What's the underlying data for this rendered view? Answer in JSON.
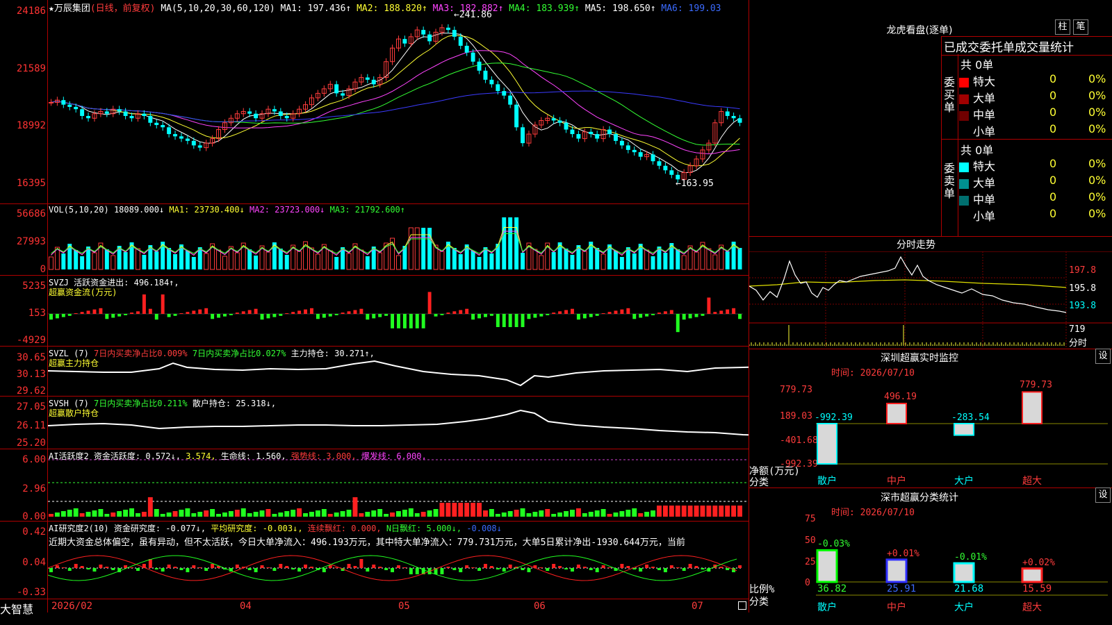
{
  "stock": {
    "name": "★万辰集团",
    "mode": "(日线，前复权)"
  },
  "ma_header": {
    "label": "MA(5,10,20,30,60,120)",
    "ma1": "MA1: 197.436↑",
    "ma2": "MA2: 188.820↑",
    "ma3": "MA3: 182.882↑",
    "ma4": "MA4: 183.939↑",
    "ma5": "MA5: 198.650↑",
    "ma6": "MA6: 199.03"
  },
  "price_axis": [
    "24186",
    "21589",
    "18992",
    "16395"
  ],
  "price_notes": {
    "high": "241.86",
    "low": "163.95"
  },
  "vol_header": {
    "label": "VOL(5,10,20)",
    "v": "18089.000↓",
    "ma1": "MA1: 23730.400↓",
    "ma2": "MA2: 23723.000↓",
    "ma3": "MA3: 21792.600↑"
  },
  "vol_axis": [
    "56686",
    "27993",
    "0"
  ],
  "svzj": {
    "label": "SVZJ",
    "name": "活跃资金进出:",
    "value": "496.184↑,",
    "sub": "超赢资金流(万元)"
  },
  "svzj_axis": [
    "5235",
    "153",
    "-4929"
  ],
  "svzl": {
    "label": "SVZL (7)",
    "t1": "7日内买卖净占比0.009%",
    "t2": "7日内买卖净占比0.027%",
    "t3": "主力持仓: 30.271↑,",
    "sub": "超赢主力持仓"
  },
  "svzl_axis": [
    "30.65",
    "30.13",
    "29.62"
  ],
  "svsh": {
    "label": "SVSH (7)",
    "t1": "7日内买卖净占比0.211%",
    "t2": "散户持仓: 25.318↓,",
    "sub": "超赢散户持仓"
  },
  "svsh_axis": [
    "27.05",
    "26.11",
    "25.20"
  ],
  "ai1": {
    "label": "AI活跃度2",
    "t1": "资金活跃度: 0.572↓,",
    "t2": "3.574,",
    "t3": "生命线: 1.560,",
    "t4": "强势线: 3.000,",
    "t5": "爆发线: 6.000,"
  },
  "ai1_axis": [
    "6.00",
    "2.96",
    "0.00"
  ],
  "ai2": {
    "label": "AI研究度2(10)",
    "t1": "资金研究度: -0.077↓,",
    "t2": "平均研究度: -0.003↓,",
    "t3": "连续飘红: 0.000,",
    "t4": "N日飘红: 5.000↓,",
    "t5": "-0.008↓",
    "comment": "近期大资金总体偏空，虽有异动，但不太活跃，今日大单净流入：496.193万元，其中特大单净流入：779.731万元，大单5日累计净出-1930.644万元，当前"
  },
  "ai2_axis": [
    "0.42",
    "0.04",
    "-0.33"
  ],
  "date_axis": [
    "2026/02",
    "04",
    "05",
    "06",
    "07"
  ],
  "brand": "大智慧",
  "right": {
    "lhb_title": "龙虎看盘(逐单)",
    "btn_zhu": "柱",
    "btn_bi": "笔",
    "stat_title": "已成交委托单成交量统计",
    "buy_side": "委买单",
    "sell_side": "委卖单",
    "buy_total": "共 0单",
    "sell_total": "共 0单",
    "buy_rows": [
      {
        "name": "特大",
        "val": "0",
        "pct": "0%",
        "color": "#ff0000"
      },
      {
        "name": "大单",
        "val": "0",
        "pct": "0%",
        "color": "#a00000"
      },
      {
        "name": "中单",
        "val": "0",
        "pct": "0%",
        "color": "#700000"
      },
      {
        "name": "小单",
        "val": "0",
        "pct": "0%",
        "color": ""
      }
    ],
    "sell_rows": [
      {
        "name": "特大",
        "val": "0",
        "pct": "0%",
        "color": "#00ffff"
      },
      {
        "name": "大单",
        "val": "0",
        "pct": "0%",
        "color": "#009090"
      },
      {
        "name": "中单",
        "val": "0",
        "pct": "0%",
        "color": "#006f6f"
      },
      {
        "name": "小单",
        "val": "0",
        "pct": "0%",
        "color": ""
      }
    ],
    "fs_title": "分时走势",
    "fs_axis": [
      "197.8",
      "195.8",
      "193.8"
    ],
    "fs_vol": "719",
    "fs_unit": "分时",
    "sz_title": "深圳超赢实时监控",
    "sz_btn": "设",
    "sz_time": "时间: 2026/07/10",
    "sz_axis": [
      "779.73",
      "189.03",
      "-401.68",
      "-992.39"
    ],
    "sz_ylabel": "净额(万元)",
    "sz_xlabel": "分类",
    "sz_bars": [
      {
        "cat": "散户",
        "val": "-992.39"
      },
      {
        "cat": "中户",
        "val": "496.19"
      },
      {
        "cat": "大户",
        "val": "-283.54"
      },
      {
        "cat": "超大",
        "val": "779.73"
      }
    ],
    "cls_title": "深市超赢分类统计",
    "cls_btn": "设",
    "cls_time": "时间: 2026/07/10",
    "cls_axis": [
      "75",
      "50",
      "25",
      "0"
    ],
    "cls_ylabel": "比例%",
    "cls_xlabel": "分类",
    "cls_bars": [
      {
        "cat": "散户",
        "pct": "36.82",
        "chg": "-0.03%"
      },
      {
        "cat": "中户",
        "pct": "25.91",
        "chg": "+0.01%"
      },
      {
        "cat": "大户",
        "pct": "21.68",
        "chg": "-0.01%"
      },
      {
        "cat": "超大",
        "pct": "15.59",
        "chg": "+0.02%"
      }
    ]
  },
  "chart_data": [
    {
      "type": "candlestick",
      "title": "万辰集团 日线",
      "series": "price",
      "ylim": [
        163.95,
        241.86
      ],
      "high": 241.86,
      "low": 163.95,
      "closes": [
        204,
        205,
        203,
        202,
        201,
        198,
        197,
        199,
        200,
        199,
        201,
        200,
        198,
        197,
        199,
        198,
        195,
        194,
        193,
        190,
        189,
        188,
        187,
        185,
        184,
        186,
        188,
        192,
        195,
        197,
        199,
        200,
        199,
        197,
        199,
        201,
        200,
        198,
        197,
        199,
        201,
        203,
        206,
        208,
        210,
        212,
        208,
        207,
        210,
        213,
        215,
        214,
        212,
        215,
        222,
        228,
        232,
        230,
        233,
        236,
        234,
        231,
        235,
        237,
        236,
        233,
        229,
        226,
        222,
        218,
        214,
        212,
        209,
        207,
        203,
        193,
        186,
        190,
        194,
        196,
        197,
        196,
        195,
        192,
        190,
        188,
        191,
        190,
        188,
        192,
        190,
        187,
        185,
        183,
        182,
        180,
        181,
        178,
        176,
        174,
        172,
        170,
        173,
        176,
        179,
        183,
        186,
        195,
        200,
        198,
        197,
        195
      ]
    },
    {
      "type": "bar",
      "series": "VOL",
      "ylim": [
        0,
        56686
      ]
    },
    {
      "type": "bar",
      "series": "SVZJ",
      "ylim": [
        -4929,
        5235
      ]
    }
  ]
}
